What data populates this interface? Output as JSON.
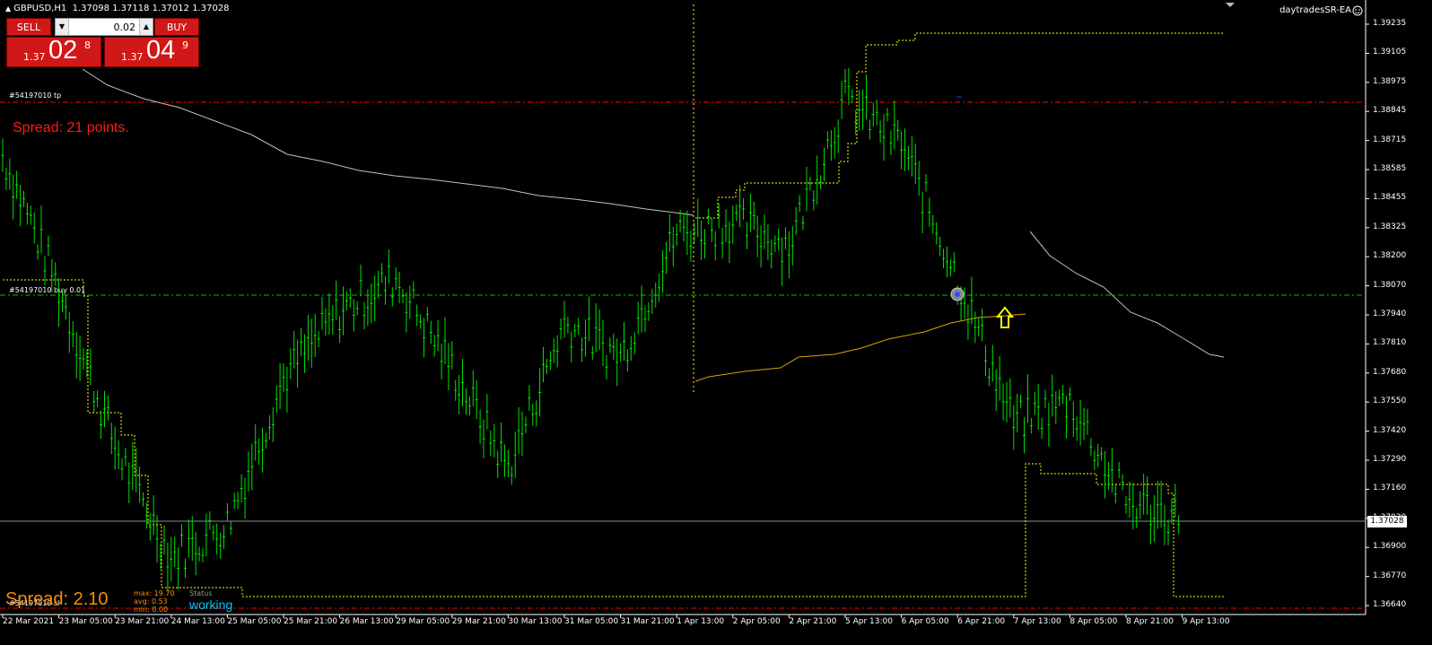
{
  "header": {
    "symbol_label": "GBPUSD,H1",
    "ohlc": "1.37098 1.37118 1.37012 1.37028",
    "ea_name": "daytradesSR-EA"
  },
  "trade_panel": {
    "sell_label": "SELL",
    "buy_label": "BUY",
    "lot_value": "0.02",
    "sell_price": {
      "prefix": "1.37",
      "big": "02",
      "pip": "8"
    },
    "buy_price": {
      "prefix": "1.37",
      "big": "04",
      "pip": "9"
    }
  },
  "overlay": {
    "spread_top": "Spread: 21 points.",
    "spread_bottom": "Spread: 2.10",
    "stats": {
      "max": "max: 19.70",
      "avg": "avg:  0.53",
      "min": "min:  0.00"
    },
    "status_label": "Status",
    "status_value": "working"
  },
  "lines": {
    "tp_label": "#54197010 tp",
    "buy_label": "#54197010 buy 0.01",
    "sl_label": "#54197010 sl"
  },
  "price_axis": [
    "1.39235",
    "1.39105",
    "1.38975",
    "1.38845",
    "1.38715",
    "1.38585",
    "1.38455",
    "1.38325",
    "1.38200",
    "1.38070",
    "1.37940",
    "1.37810",
    "1.37680",
    "1.37550",
    "1.37420",
    "1.37290",
    "1.37160",
    "1.37030",
    "1.36900",
    "1.36770",
    "1.36640"
  ],
  "current_price": "1.37028",
  "time_axis": [
    "22 Mar 2021",
    "23 Mar 05:00",
    "23 Mar 21:00",
    "24 Mar 13:00",
    "25 Mar 05:00",
    "25 Mar 21:00",
    "26 Mar 13:00",
    "29 Mar 05:00",
    "29 Mar 21:00",
    "30 Mar 13:00",
    "31 Mar 05:00",
    "31 Mar 21:00",
    "1 Apr 13:00",
    "2 Apr 05:00",
    "2 Apr 21:00",
    "5 Apr 13:00",
    "6 Apr 05:00",
    "6 Apr 21:00",
    "7 Apr 13:00",
    "8 Apr 05:00",
    "8 Apr 21:00",
    "9 Apr 13:00"
  ],
  "colors": {
    "candle": "#00e000",
    "ma_gray": "#c0c0c0",
    "ma_orange": "#e0a000",
    "sr_dotted": "#ffff00",
    "tp_line": "#ff0000",
    "buy_line": "#00c000",
    "price_line": "#8090a0"
  },
  "chart_data": {
    "type": "line",
    "symbol": "GBPUSD",
    "timeframe": "H1",
    "ylim": [
      1.3662,
      1.3932
    ],
    "open_trade": {
      "tp": 1.3888,
      "entry": 1.3801,
      "sl": 1.3665,
      "lots": 0.01
    },
    "close_path": [
      [
        "22 Mar 2021",
        1.3865
      ],
      [
        "23 Mar 05:00",
        1.3805
      ],
      [
        "23 Mar 21:00",
        1.3735
      ],
      [
        "24 Mar 13:00",
        1.3685
      ],
      [
        "25 Mar 05:00",
        1.37
      ],
      [
        "25 Mar 21:00",
        1.3765
      ],
      [
        "26 Mar 13:00",
        1.3795
      ],
      [
        "29 Mar 05:00",
        1.381
      ],
      [
        "29 Mar 21:00",
        1.377
      ],
      [
        "30 Mar 13:00",
        1.3725
      ],
      [
        "31 Mar 05:00",
        1.379
      ],
      [
        "31 Mar 21:00",
        1.3775
      ],
      [
        "1 Apr 13:00",
        1.383
      ],
      [
        "2 Apr 05:00",
        1.3835
      ],
      [
        "2 Apr 21:00",
        1.3825
      ],
      [
        "5 Apr 13:00",
        1.389
      ],
      [
        "6 Apr 05:00",
        1.387
      ],
      [
        "6 Apr 21:00",
        1.381
      ],
      [
        "7 Apr 13:00",
        1.3745
      ],
      [
        "8 Apr 05:00",
        1.3755
      ],
      [
        "8 Apr 21:00",
        1.371
      ],
      [
        "9 Apr 13:00",
        1.3703
      ]
    ]
  }
}
